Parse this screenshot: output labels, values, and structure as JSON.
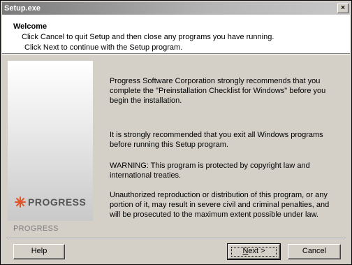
{
  "window": {
    "title": "Setup.exe",
    "close_glyph": "×"
  },
  "header": {
    "title": "Welcome",
    "line1": "Click Cancel to quit Setup and then close any programs you have running.",
    "line2": "Click Next to continue with the Setup program."
  },
  "side_panel": {
    "logo_text": "PROGRESS",
    "logo_icon": "starburst-icon",
    "brand_label": "PROGRESS",
    "accent_color": "#e2552b"
  },
  "body": {
    "p1": "Progress Software Corporation strongly recommends that you complete the \"Preinstallation Checklist for Windows\" before you begin the installation.",
    "p2": "It is strongly recommended that you exit all Windows programs before running this Setup program.",
    "p3": "WARNING: This program is protected by copyright law and international treaties.",
    "p4": "Unauthorized reproduction or distribution of this program, or any portion of it, may result in severe civil and criminal penalties, and will be prosecuted to the maximum extent possible under law."
  },
  "buttons": {
    "help": "Help",
    "next_mnemonic": "N",
    "next_rest": "ext >",
    "cancel": "Cancel"
  }
}
